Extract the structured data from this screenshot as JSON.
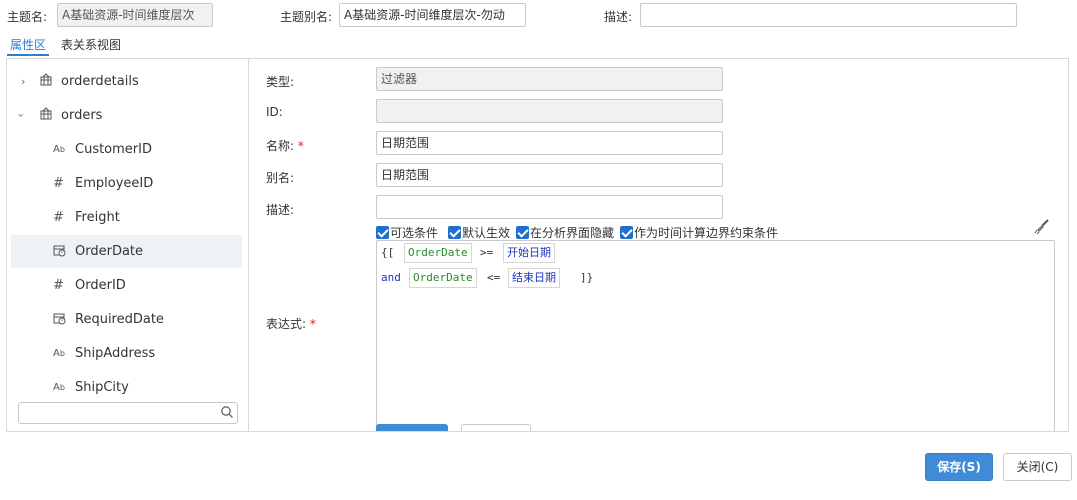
{
  "header": {
    "subject_name_label": "主题名:",
    "subject_name_value": "A基础资源-时间维度层次",
    "subject_alias_label": "主题别名:",
    "subject_alias_value": "A基础资源-时间维度层次-勿动",
    "description_label": "描述:",
    "description_value": ""
  },
  "tabs": [
    {
      "label": "属性区",
      "active": true
    },
    {
      "label": "表关系视图",
      "active": false
    }
  ],
  "tree": {
    "items": [
      {
        "label": "orderdetails",
        "icon": "table-icon",
        "expanded": false
      },
      {
        "label": "orders",
        "icon": "table-icon",
        "expanded": true
      },
      {
        "label": "CustomerID",
        "icon": "text-field-icon"
      },
      {
        "label": "EmployeeID",
        "icon": "number-field-icon"
      },
      {
        "label": "Freight",
        "icon": "number-field-icon"
      },
      {
        "label": "OrderDate",
        "icon": "date-field-icon",
        "selected": true
      },
      {
        "label": "OrderID",
        "icon": "number-field-icon"
      },
      {
        "label": "RequiredDate",
        "icon": "date-field-icon"
      },
      {
        "label": "ShipAddress",
        "icon": "text-field-icon"
      },
      {
        "label": "ShipCity",
        "icon": "text-field-icon"
      }
    ],
    "search_placeholder": ""
  },
  "form": {
    "type_label": "类型:",
    "type_value": "过滤器",
    "id_label": "ID:",
    "id_value": "",
    "name_label": "名称:",
    "name_value": "日期范围",
    "alias_label": "别名:",
    "alias_value": "日期范围",
    "desc_label": "描述:",
    "desc_value": "",
    "expression_label": "表达式:",
    "required_mark": "*",
    "checkboxes": [
      {
        "label": "可选条件",
        "checked": true
      },
      {
        "label": "默认生效",
        "checked": true
      },
      {
        "label": "在分析界面隐藏",
        "checked": true
      },
      {
        "label": "作为时间计算边界约束条件",
        "checked": true
      }
    ],
    "expression": {
      "open": "{[",
      "field1": "OrderDate",
      "op1": ">=",
      "param1": "开始日期",
      "and": "and",
      "field2": "OrderDate",
      "op2": "<=",
      "param2": "结束日期",
      "close": "]}"
    }
  },
  "footer": {
    "save_label": "保存(S)",
    "close_label": "关闭(C)"
  },
  "colors": {
    "accent": "#3f8bd8",
    "tab_active": "#2d7ecf",
    "required": "#e02020",
    "keyword": "#1b35c2",
    "field": "#2a8a2a"
  }
}
